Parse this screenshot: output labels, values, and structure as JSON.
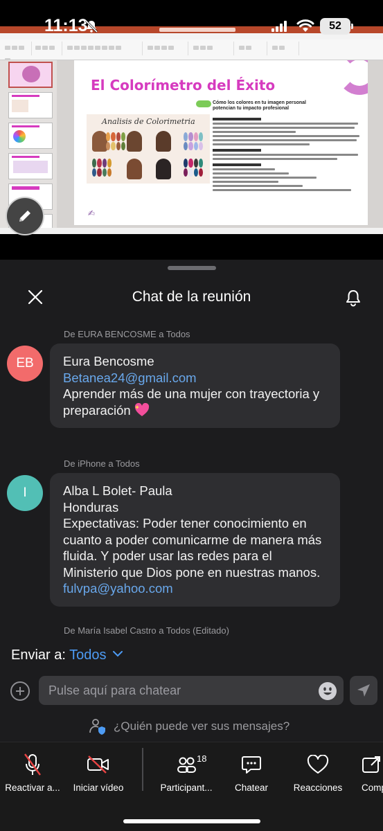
{
  "status_bar": {
    "time": "11:13",
    "battery": "52"
  },
  "shared_screen": {
    "slide_title": "El Colorímetro del Éxito",
    "slide_subtitle": "Cómo los colores en tu imagen personal potencian tu impacto profesional",
    "image_caption": "Analisis de Colorimetria"
  },
  "header": {
    "title": "Chat de la reunión"
  },
  "messages": [
    {
      "from": "De EURA BENCOSME a Todos",
      "initials": "EB",
      "avatar_color": "#f26b6b",
      "lines": [
        "Eura Bencosme"
      ],
      "email": "Betanea24@gmail.com",
      "text": "Aprender más de una mujer con trayectoria y preparación"
    },
    {
      "from": "De iPhone a Todos",
      "initials": "I",
      "avatar_color": "#52bfb5",
      "lines": [
        "Alba L Bolet- Paula",
        "Honduras"
      ],
      "text": "Expectativas:   Poder tener conocimiento en cuanto a poder comunicarme de manera más fluida.   Y poder usar las redes para el Ministerio que Dios pone en nuestras manos.",
      "email": "fulvpa@yahoo.com"
    },
    {
      "from": "De María Isabel Castro a Todos  (Editado)"
    }
  ],
  "composer": {
    "send_to_label": "Enviar a:",
    "send_to_value": "Todos",
    "placeholder": "Pulse aquí para chatear",
    "privacy_text": "¿Quién puede ver sus mensajes?"
  },
  "toolbar": {
    "unmute": "Reactivar a...",
    "start_video": "Iniciar vídeo",
    "participants": "Participant...",
    "participants_count": "18",
    "chat": "Chatear",
    "reactions": "Reacciones",
    "more": "Comp"
  },
  "colors": {
    "accent": "#4d9bf4",
    "email_link": "#69a8ec",
    "mute_red": "#e84343"
  }
}
